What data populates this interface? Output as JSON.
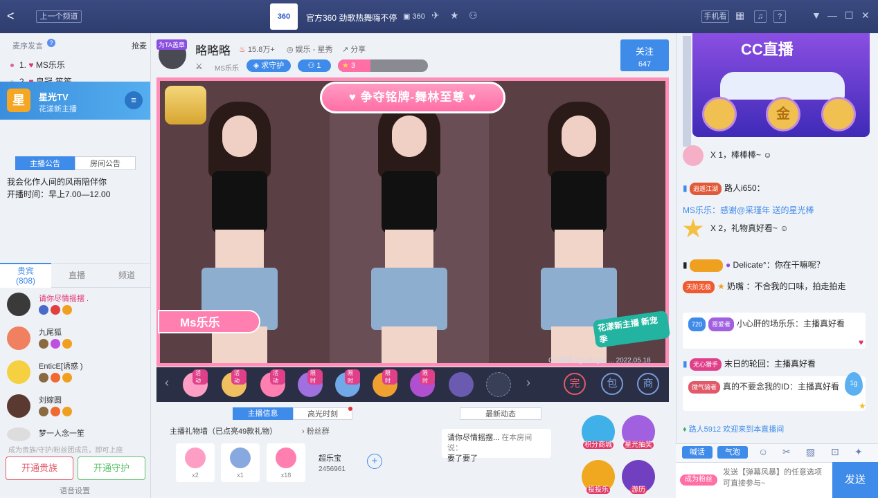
{
  "topbar": {
    "back": "<",
    "prev_channel": "上一个频道",
    "logo": "360",
    "title": "官方360 劲歌热舞嗨不停",
    "channel_no": "360",
    "phone_watch": "手机看"
  },
  "left": {
    "queue_label": "麦序发言",
    "grab_mic": "抢麦",
    "queue": [
      {
        "rank": "1.",
        "name": "MS乐乐"
      },
      {
        "rank": "2.",
        "name": "皇冠-笙笙"
      }
    ],
    "tv_name": "星光TV",
    "tv_sub": "花漾新主播",
    "tv_icon": "星",
    "tab_anchor_notice": "主播公告",
    "tab_room_notice": "房间公告",
    "notice_line1": "我会化作人间的风雨陪伴你",
    "notice_line2": "开播时间：早上7.00—12.00",
    "tab_noble": "贵宾",
    "noble_count": "(808)",
    "tab_live": "直播",
    "tab_channel": "频道",
    "users": [
      {
        "name": "请你尽情摇摆 ."
      },
      {
        "name": "九尾狐"
      },
      {
        "name": "EnticE[诱惑 )"
      },
      {
        "name": "刘嫁圆"
      },
      {
        "name": "梦一人念一笙"
      }
    ],
    "footer_hint": "成为贵族/守护/粉丝团成员，即可上座",
    "open_noble": "开通贵族",
    "open_guard": "开通守护",
    "voice_settings": "语音设置"
  },
  "anchor": {
    "tag": "为TA盖章",
    "name": "略略略",
    "heat": "15.8万+",
    "category": "娱乐 - 星秀",
    "share": "分享",
    "host_name": "MS乐乐",
    "seek_guard": "求守护",
    "fans": "1",
    "stars": "3",
    "follow": "关注",
    "follow_count": "647"
  },
  "video": {
    "banner": "争夺铭牌-舞林至尊",
    "name_plate": "Ms乐乐",
    "side_text": "花漾新主播 新宠季",
    "watermark": "CC直播 BgLWzgW ... 2022.05.18"
  },
  "giftbar": {
    "tags": [
      "活动",
      "活动",
      "活动",
      "限时",
      "限时",
      "限时",
      "限时",
      "",
      ""
    ]
  },
  "info": {
    "tab_host": "主播信息",
    "tab_highlight": "高光时刻",
    "tab_news": "最新动态",
    "gift_wall": "主播礼物墙（已点亮49款礼物）",
    "fan_group": "粉丝群",
    "gift_counts": [
      "x2",
      "x1",
      "x18"
    ],
    "treasure_title": "超乐宝",
    "treasure_no": "2456961",
    "bubble_user": "请你尽情摇摆...",
    "bubble_in": "在本房间说：",
    "bubble_msg": "要了要了",
    "points_mall": "积分商城",
    "star_lottery": "星光抽奖",
    "touzi": "投投乐",
    "travel": "游历"
  },
  "right": {
    "promo_brand": "CC直播",
    "msgs": [
      {
        "text": "X 1，棒棒棒~"
      },
      {
        "tag": "逍遥江湖",
        "text": "路人i650："
      },
      {
        "text": "MS乐乐：感谢@采瑾年  送的星光棒"
      },
      {
        "text": "X 2，礼物真好看~"
      },
      {
        "text": "Delicate°：你在干嘛呢？"
      },
      {
        "tag": "天阶无极",
        "text": "奶嘴 ：不合我的口味，拍走拍走"
      },
      {
        "level": "720",
        "tag": "哥爱者",
        "text": "小心肝的场乐乐：主播真好看"
      },
      {
        "tag": "无心猎手",
        "text": "末日的轮回：主播真好看"
      },
      {
        "tag": "微气骑者",
        "text": "真的不要念我的ID：主播真好看"
      },
      {
        "text": "路人5912 欢迎来到本直播间"
      }
    ],
    "mini_tab_speak": "喊话",
    "mini_tab_bubble": "气泡",
    "fan_badge": "成为粉丝",
    "input_placeholder": "发送【弹幕风暴】的任意选项可直接参与~",
    "send": "发送",
    "float_badge": "1g"
  },
  "colors": {
    "topbar": "#34447a",
    "accent_blue": "#3f8bea",
    "pink": "#ff7fb0",
    "orange": "#ff8a3d"
  }
}
